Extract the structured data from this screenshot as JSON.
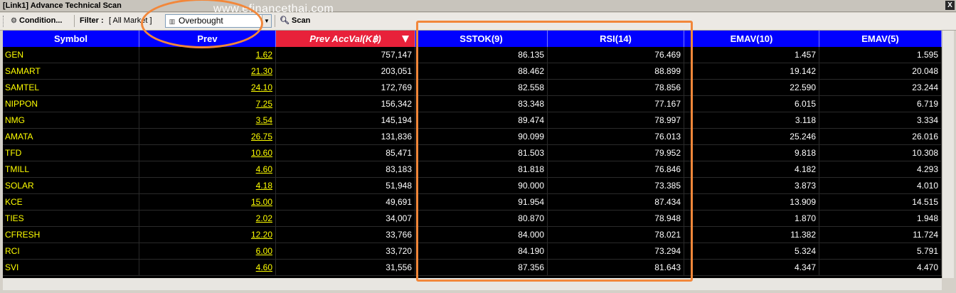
{
  "window": {
    "title": "[Link1] Advance Technical Scan",
    "close_label": "X"
  },
  "watermark": "www.efinancethai.com",
  "toolbar": {
    "condition_label": "Condition...",
    "filter_label": "Filter :",
    "filter_value": "[ All Market ]",
    "scan_type": "Overbought",
    "scan_label": "Scan"
  },
  "columns": [
    "Symbol",
    "Prev",
    "Prev AccVal(K฿)",
    "SSTOK(9)",
    "RSI(14)",
    "EMAV(10)",
    "EMAV(5)"
  ],
  "sorted_column": "Prev AccVal(K฿)",
  "rows": [
    [
      "GEN",
      "1.62",
      "757,147",
      "86.135",
      "76.469",
      "1.457",
      "1.595"
    ],
    [
      "SAMART",
      "21.30",
      "203,051",
      "88.462",
      "88.899",
      "19.142",
      "20.048"
    ],
    [
      "SAMTEL",
      "24.10",
      "172,769",
      "82.558",
      "78.856",
      "22.590",
      "23.244"
    ],
    [
      "NIPPON",
      "7.25",
      "156,342",
      "83.348",
      "77.167",
      "6.015",
      "6.719"
    ],
    [
      "NMG",
      "3.54",
      "145,194",
      "89.474",
      "78.997",
      "3.118",
      "3.334"
    ],
    [
      "AMATA",
      "26.75",
      "131,836",
      "90.099",
      "76.013",
      "25.246",
      "26.016"
    ],
    [
      "TFD",
      "10.60",
      "85,471",
      "81.503",
      "79.952",
      "9.818",
      "10.308"
    ],
    [
      "TMILL",
      "4.60",
      "83,183",
      "81.818",
      "76.846",
      "4.182",
      "4.293"
    ],
    [
      "SOLAR",
      "4.18",
      "51,948",
      "90.000",
      "73.385",
      "3.873",
      "4.010"
    ],
    [
      "KCE",
      "15.00",
      "49,691",
      "91.954",
      "87.434",
      "13.909",
      "14.515"
    ],
    [
      "TIES",
      "2.02",
      "34,007",
      "80.870",
      "78.948",
      "1.870",
      "1.948"
    ],
    [
      "CFRESH",
      "12.20",
      "33,766",
      "84.000",
      "78.021",
      "11.382",
      "11.724"
    ],
    [
      "RCI",
      "6.00",
      "33,720",
      "84.190",
      "73.294",
      "5.324",
      "5.791"
    ],
    [
      "SVI",
      "4.60",
      "31,556",
      "87.356",
      "81.643",
      "4.347",
      "4.470"
    ]
  ],
  "colors": {
    "header_bg": "#0000ff",
    "sorted_header_bg": "#e8213a",
    "symbol_text": "#ffff00",
    "grid_bg": "#000000",
    "annotation": "#f2873a"
  }
}
